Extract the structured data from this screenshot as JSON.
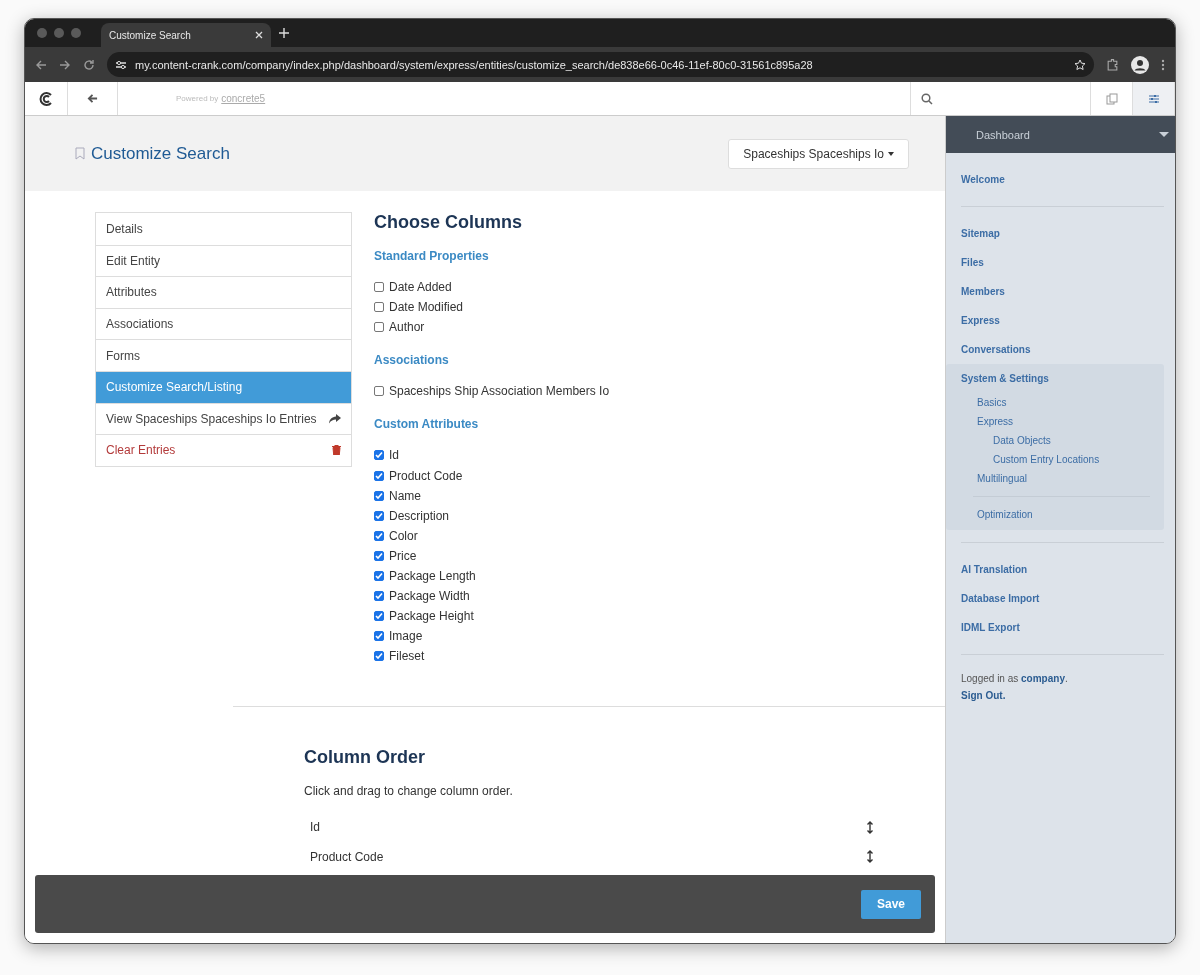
{
  "browser": {
    "tab_title": "Customize Search",
    "url": "my.content-crank.com/company/index.php/dashboard/system/express/entities/customize_search/de838e66-0c46-11ef-80c0-31561c895a28"
  },
  "toolbar": {
    "powered_by": "Powered by",
    "brand_link": "concrete5"
  },
  "header": {
    "title": "Customize Search",
    "entity_menu": "Spaceships Spaceships Io"
  },
  "nav": [
    {
      "label": "Details",
      "selected": false,
      "kind": "plain"
    },
    {
      "label": "Edit Entity",
      "selected": false,
      "kind": "plain"
    },
    {
      "label": "Attributes",
      "selected": false,
      "kind": "plain"
    },
    {
      "label": "Associations",
      "selected": false,
      "kind": "plain"
    },
    {
      "label": "Forms",
      "selected": false,
      "kind": "plain"
    },
    {
      "label": "Customize Search/Listing",
      "selected": true,
      "kind": "plain"
    },
    {
      "label": "View Spaceships Spaceships Io Entries",
      "selected": false,
      "kind": "share"
    },
    {
      "label": "Clear Entries",
      "selected": false,
      "kind": "danger"
    }
  ],
  "choose_columns": {
    "title": "Choose Columns",
    "groups": [
      {
        "title": "Standard Properties",
        "items": [
          {
            "label": "Date Added",
            "checked": false
          },
          {
            "label": "Date Modified",
            "checked": false
          },
          {
            "label": "Author",
            "checked": false
          }
        ]
      },
      {
        "title": "Associations",
        "items": [
          {
            "label": "Spaceships Ship Association Members Io",
            "checked": false
          }
        ]
      },
      {
        "title": "Custom Attributes",
        "items": [
          {
            "label": "Id",
            "checked": true
          },
          {
            "label": "Product Code",
            "checked": true
          },
          {
            "label": "Name",
            "checked": true
          },
          {
            "label": "Description",
            "checked": true
          },
          {
            "label": "Color",
            "checked": true
          },
          {
            "label": "Price",
            "checked": true
          },
          {
            "label": "Package Length",
            "checked": true
          },
          {
            "label": "Package Width",
            "checked": true
          },
          {
            "label": "Package Height",
            "checked": true
          },
          {
            "label": "Image",
            "checked": true
          },
          {
            "label": "Fileset",
            "checked": true
          }
        ]
      }
    ]
  },
  "column_order": {
    "title": "Column Order",
    "hint": "Click and drag to change column order.",
    "rows": [
      "Id",
      "Product Code"
    ]
  },
  "save_button": "Save",
  "sidebar": {
    "title": "Dashboard",
    "sections": [
      [
        {
          "label": "Welcome"
        }
      ],
      [
        {
          "label": "Sitemap"
        },
        {
          "label": "Files"
        },
        {
          "label": "Members"
        },
        {
          "label": "Express"
        },
        {
          "label": "Conversations"
        },
        {
          "label": "System & Settings",
          "expanded": true,
          "children": [
            {
              "label": "Basics"
            },
            {
              "label": "Express",
              "children": [
                {
                  "label": "Data Objects"
                },
                {
                  "label": "Custom Entry Locations"
                }
              ]
            },
            {
              "label": "Multilingual"
            },
            {
              "label": "Optimization",
              "divider_before": true
            }
          ]
        }
      ],
      [
        {
          "label": "AI Translation"
        },
        {
          "label": "Database Import"
        },
        {
          "label": "IDML Export"
        }
      ]
    ],
    "logged_in_prefix": "Logged in as",
    "user": "company",
    "logged_in_suffix": ".",
    "sign_out": "Sign Out."
  }
}
